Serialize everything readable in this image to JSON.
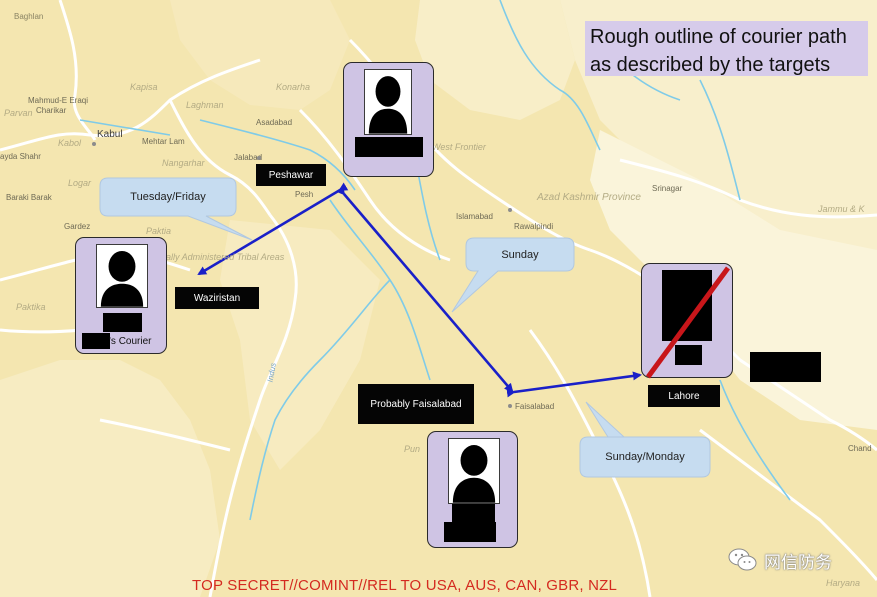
{
  "title": "Rough outline of courier path as described by the targets",
  "classification": "TOP SECRET//COMINT//REL TO USA, AUS, CAN, GBR, NZL",
  "watermark": {
    "text": "网信防务",
    "icon": "wechat-icon"
  },
  "locations": {
    "peshawar": "Peshawar",
    "waziristan": "Waziristan",
    "probably_faisalabad": "Probably Faisalabad",
    "lahore": "Lahore"
  },
  "callouts": {
    "tuesday_friday": "Tuesday/Friday",
    "sunday": "Sunday",
    "sunday_monday": "Sunday/Monday"
  },
  "couriers": {
    "waziristan_caption": "'s Courier"
  },
  "map_places": {
    "baghlan": "Baghlan",
    "kapisa": "Kapisa",
    "mahmud_e_eraqi": "Mahmud-E Eraqi",
    "charikar": "Charikar",
    "parvan": "Parvan",
    "laghman": "Laghman",
    "konarha": "Konarha",
    "kabul": "Kabul",
    "kabol": "Kabol",
    "mehtar_lam": "Mehtar Lam",
    "asadabad": "Asadabad",
    "jalabad": "Jalabad",
    "nangarhar": "Nangarhar",
    "ayda_shahr": "ayda Shahr",
    "logar": "Logar",
    "baraki_barak": "Baraki Barak",
    "paktia": "Paktia",
    "gardez": "Gardez",
    "paktika": "Paktika",
    "pesh": "Pesh",
    "administered_areas": "ally Administered Tribal Areas",
    "west_frontier": "West Frontier",
    "islamabad": "Islamabad",
    "rawalpindi": "Rawalpindi",
    "azad_kashmir": "Azad Kashmir Province",
    "srinagar": "Srinagar",
    "jammu": "Jammu & K",
    "indus": "Indus",
    "faisalabad": "Faisalabad",
    "punjab": "Pun",
    "chand": "Chand",
    "haryana": "Haryana"
  },
  "colors": {
    "map_land": "#f6eab8",
    "region_light": "#faf3d6",
    "border_line": "#ffffff",
    "river": "#7fcbe8",
    "path_arrow": "#1a20c8",
    "card_fill": "#cfc4e4",
    "title_fill": "#d6cbea",
    "callout_fill": "#c6dcf0",
    "classification": "#d42a20",
    "strike": "#c8161a"
  }
}
